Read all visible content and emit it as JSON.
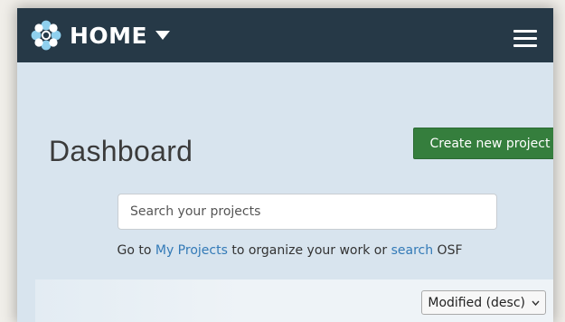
{
  "navbar": {
    "brand_label": "HOME",
    "logo_icon": "osf-flower-logo-icon",
    "caret_icon": "caret-down-icon",
    "menu_icon": "hamburger-menu-icon",
    "background_color": "#263947",
    "logo_color": "#7fc6e6"
  },
  "dashboard": {
    "title": "Dashboard",
    "create_button_label": "Create new project",
    "create_button_color": "#357e3d",
    "search": {
      "placeholder": "Search your projects",
      "value": ""
    },
    "help": {
      "prefix": "Go to ",
      "my_projects_link": "My Projects",
      "middle": " to organize your work or ",
      "search_link": "search",
      "suffix": " OSF"
    },
    "link_color": "#337ab7"
  },
  "projects": {
    "sort": {
      "selected": "Modified (desc)",
      "icon": "chevron-down-icon"
    }
  }
}
